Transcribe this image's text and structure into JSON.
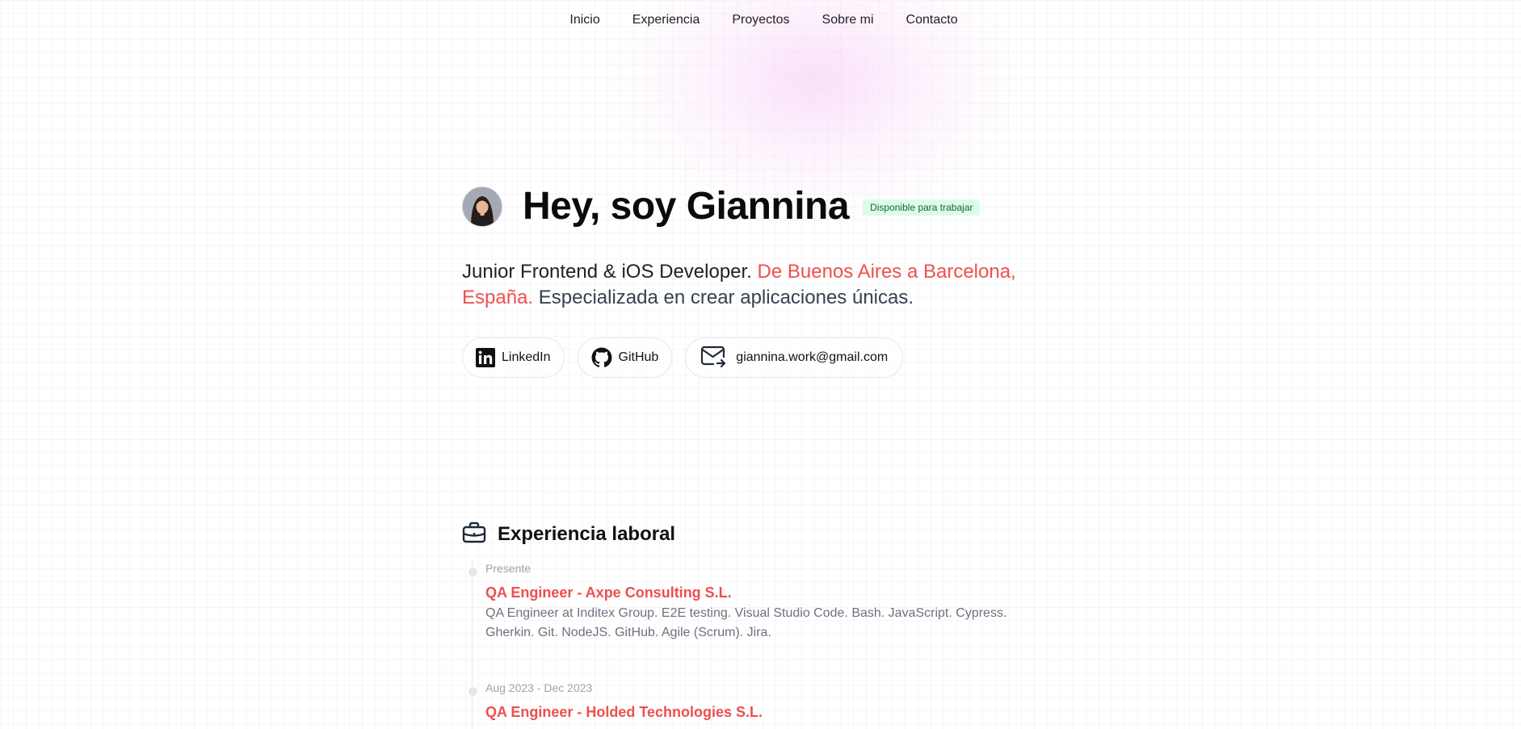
{
  "nav": {
    "items": [
      {
        "label": "Inicio"
      },
      {
        "label": "Experiencia"
      },
      {
        "label": "Proyectos"
      },
      {
        "label": "Sobre mi"
      },
      {
        "label": "Contacto"
      }
    ]
  },
  "hero": {
    "title": "Hey, soy Giannina",
    "badge": "Disponible para trabajar",
    "desc_part1": "Junior Frontend & iOS Developer. ",
    "desc_accent": "De Buenos Aires a Barcelona, España.",
    "desc_part2": " Especializada en crear aplicaciones únicas.",
    "links": {
      "linkedin": "LinkedIn",
      "github": "GitHub",
      "email": "giannina.work@gmail.com"
    }
  },
  "experience": {
    "heading": "Experiencia laboral",
    "items": [
      {
        "date": "Presente",
        "title": "QA Engineer - Axpe Consulting S.L.",
        "desc": "QA Engineer at Inditex Group. E2E testing. Visual Studio Code. Bash. JavaScript. Cypress. Gherkin. Git. NodeJS. GitHub. Agile (Scrum). Jira."
      },
      {
        "date": "Aug 2023 - Dec 2023",
        "title": "QA Engineer - Holded Technologies S.L.",
        "desc": ""
      }
    ]
  },
  "colors": {
    "accent": "#ef4f4f",
    "badge_bg": "#dcfce7",
    "badge_text": "#166534"
  },
  "icons": [
    "avatar-photo",
    "linkedin-icon",
    "github-icon",
    "mail-icon",
    "briefcase-icon"
  ]
}
